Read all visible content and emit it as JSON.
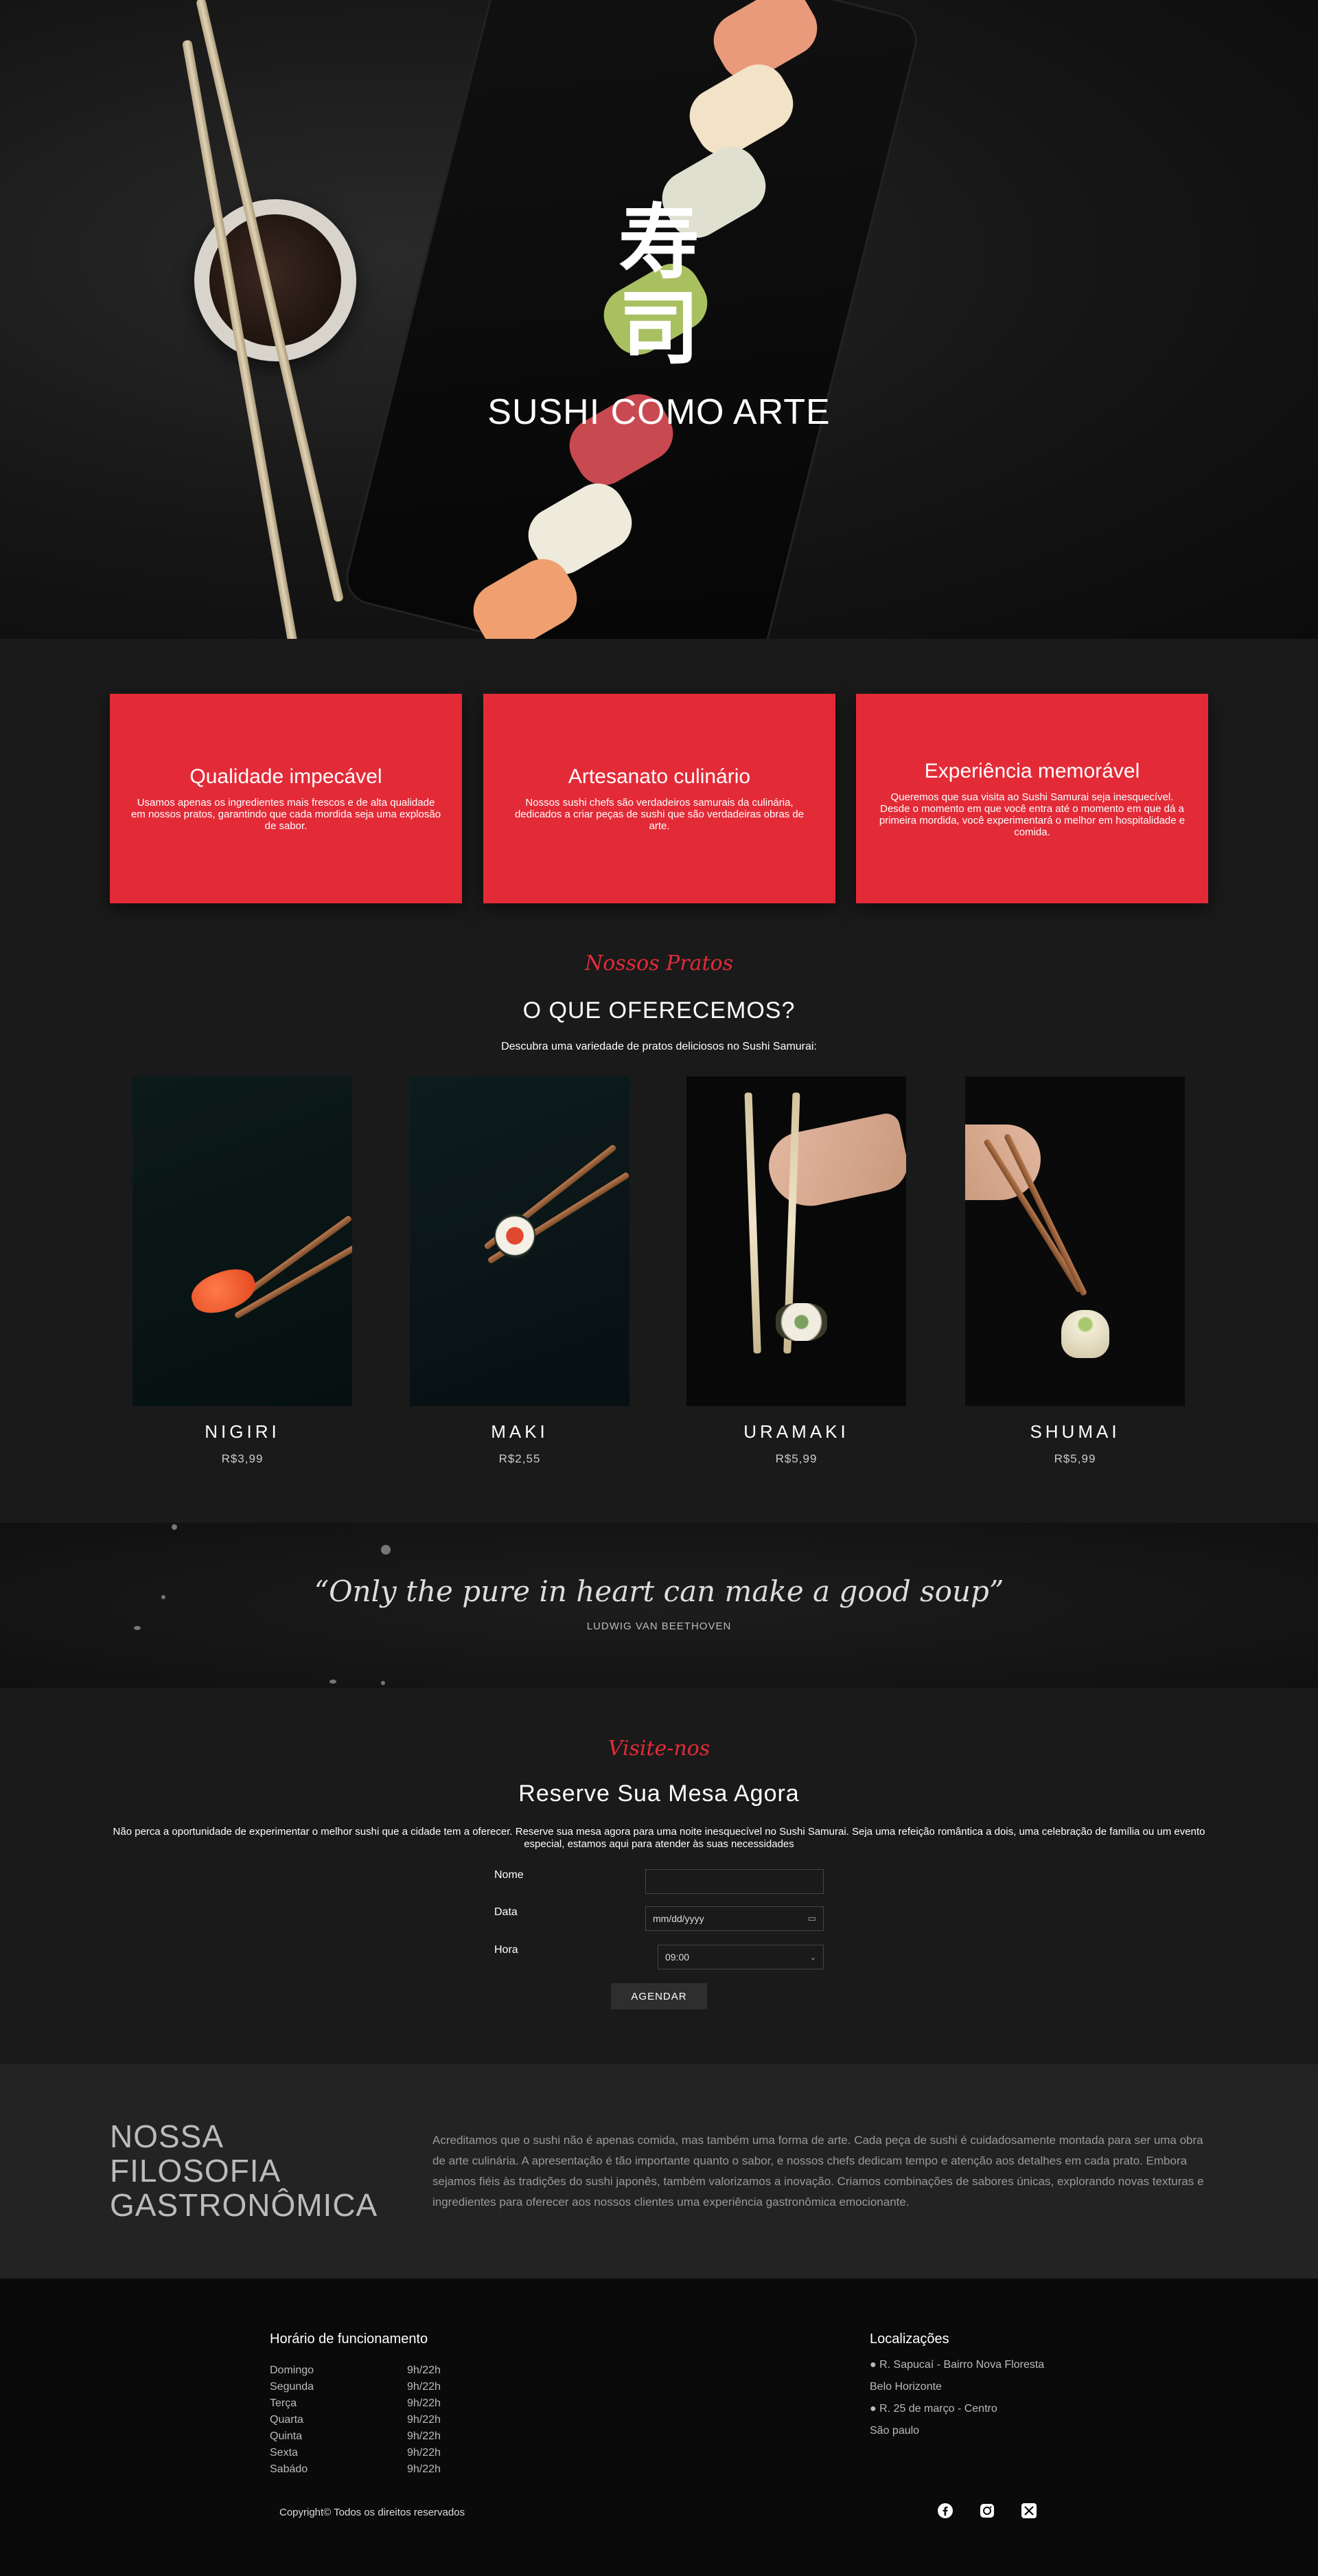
{
  "hero": {
    "kanji_1": "寿",
    "kanji_2": "司",
    "tagline": "SUSHI COMO ARTE"
  },
  "features": [
    {
      "title": "Qualidade impecável",
      "text": "Usamos apenas os ingredientes mais frescos e de alta qualidade em nossos pratos, garantindo que cada mordida seja uma explosão de sabor."
    },
    {
      "title": "Artesanato culinário",
      "text": "Nossos sushi chefs são verdadeiros samurais da culinária, dedicados a criar peças de sushi que são verdadeiras obras de arte."
    },
    {
      "title": "Experiência memorável",
      "text": "Queremos que sua visita ao Sushi Samurai seja inesquecível. Desde o momento em que você entra até o momento em que dá a primeira mordida, você experimentará o melhor em hospitalidade e comida."
    }
  ],
  "dishes_section": {
    "script": "Nossos Pratos",
    "title": "O QUE OFERECEMOS?",
    "subtitle": "Descubra uma variedade de pratos deliciosos no Sushi Samurai:",
    "dishes": [
      {
        "name": "NIGIRI",
        "price": "R$3,99"
      },
      {
        "name": "MAKI",
        "price": "R$2,55"
      },
      {
        "name": "URAMAKI",
        "price": "R$5,99"
      },
      {
        "name": "SHUMAI",
        "price": "R$5,99"
      }
    ]
  },
  "quote": {
    "text": "“Only the pure in heart can make a good soup”",
    "author": "LUDWIG VAN BEETHOVEN"
  },
  "reservation": {
    "script": "Visite-nos",
    "title": "Reserve Sua Mesa Agora",
    "description": "Não perca a oportunidade de experimentar o melhor sushi que a cidade tem a oferecer. Reserve sua mesa agora para uma noite inesquecível no Sushi Samurai. Seja uma refeição romântica a dois, uma celebração de família ou um evento especial, estamos aqui para atender às suas necessidades",
    "name_label": "Nome",
    "date_label": "Data",
    "date_placeholder": "mm/dd/yyyy",
    "time_label": "Hora",
    "time_value": "09:00",
    "submit_label": "AGENDAR"
  },
  "philosophy": {
    "title": "NOSSA FILOSOFIA GASTRONÔMICA",
    "text": "Acreditamos que o sushi não é apenas comida, mas também uma forma de arte. Cada peça de sushi é cuidadosamente montada para ser uma obra de arte culinária. A apresentação é tão importante quanto o sabor, e nossos chefs dedicam tempo e atenção aos detalhes em cada prato. Embora sejamos fiéis às tradições do sushi japonês, também valorizamos a inovação. Criamos combinações de sabores únicas, explorando novas texturas e ingredientes para oferecer aos nossos clientes uma experiência gastronômica emocionante."
  },
  "footer": {
    "hours_title": "Horário de funcionamento",
    "hours": [
      {
        "day": "Domingo",
        "time": "9h/22h"
      },
      {
        "day": "Segunda",
        "time": "9h/22h"
      },
      {
        "day": "Terça",
        "time": "9h/22h"
      },
      {
        "day": "Quarta",
        "time": "9h/22h"
      },
      {
        "day": "Quinta",
        "time": "9h/22h"
      },
      {
        "day": "Sexta",
        "time": "9h/22h"
      },
      {
        "day": "Sabádo",
        "time": "9h/22h"
      }
    ],
    "locations_title": "Localizações",
    "locations": [
      "● R. Sapucaí - Bairro Nova Floresta",
      "Belo Horizonte",
      "● R. 25 de março - Centro",
      "São paulo"
    ],
    "copyright": "Copyright© Todos os direitos reservados",
    "social_icons": [
      "facebook-icon",
      "instagram-icon",
      "x-icon"
    ]
  },
  "colors": {
    "accent": "#e32b38",
    "background": "#1a1a1a",
    "footer": "#0a0a0a"
  }
}
